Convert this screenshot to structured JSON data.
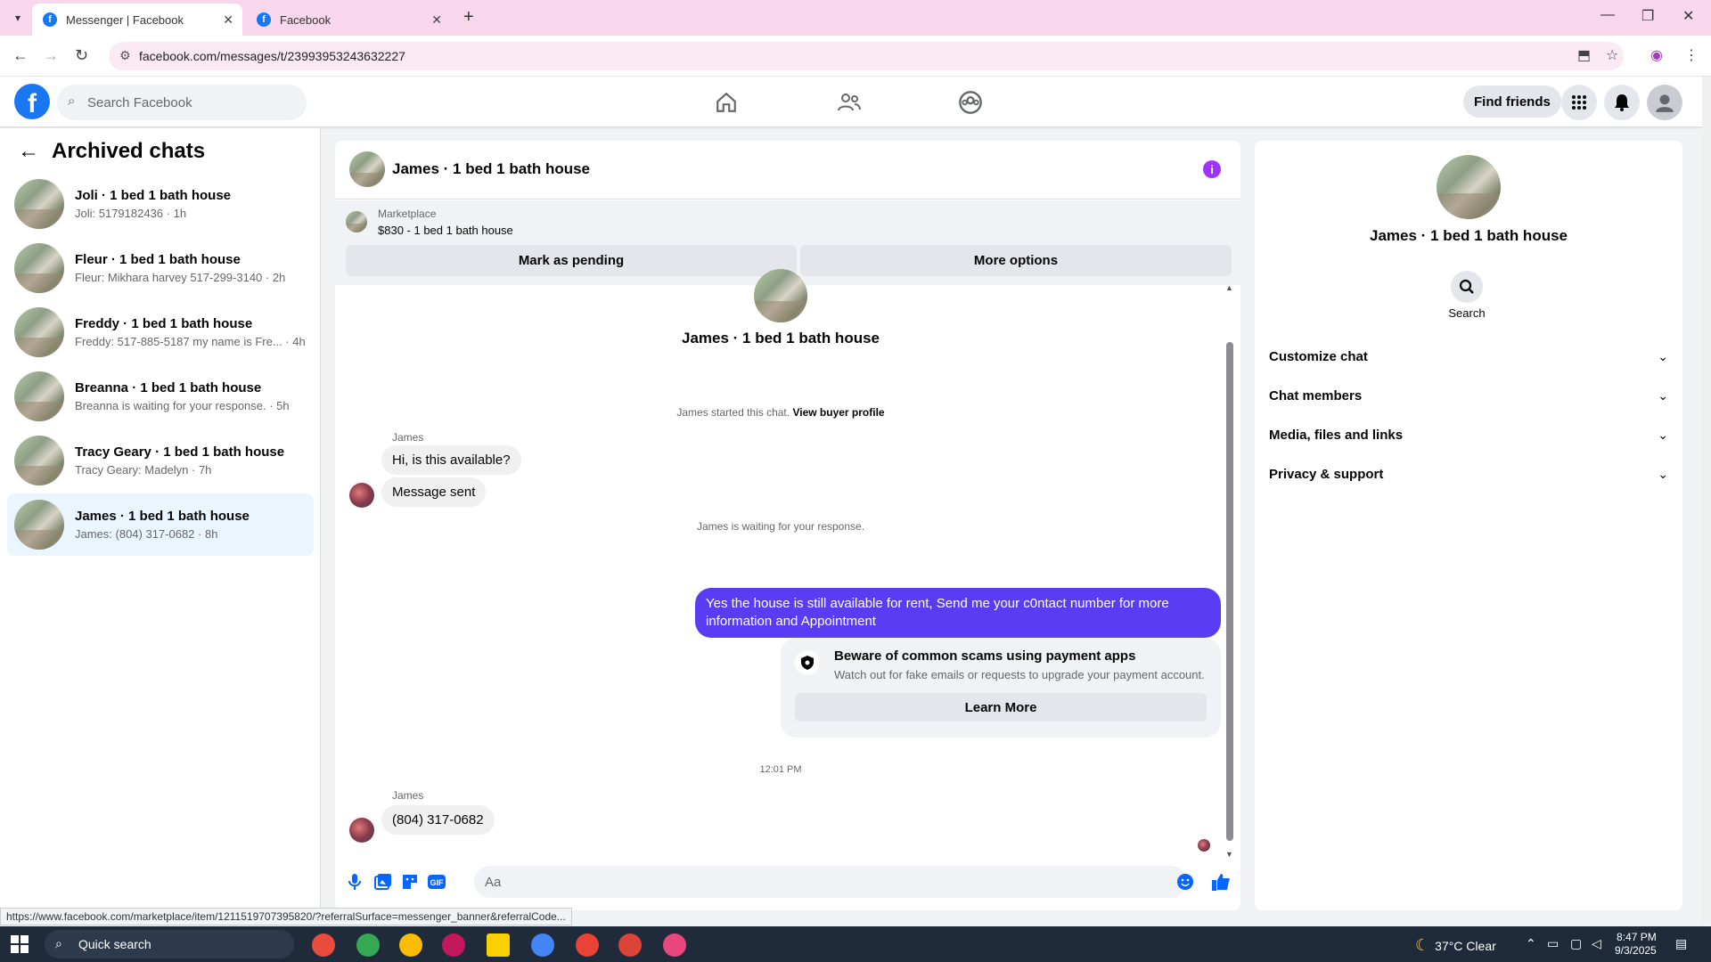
{
  "browser": {
    "tabs": [
      {
        "label": "Messenger | Facebook",
        "active": true
      },
      {
        "label": "Facebook",
        "active": false
      }
    ],
    "url": "facebook.com/messages/t/23993953243632227",
    "status_url": "https://www.facebook.com/marketplace/item/1211519707395820/?referralSurface=messenger_banner&referralCode..."
  },
  "fb_header": {
    "search_placeholder": "Search Facebook",
    "find_friends": "Find friends"
  },
  "sidebar": {
    "title": "Archived chats",
    "chats": [
      {
        "title": "Joli · 1 bed 1 bath house",
        "preview": "Joli: 5179182436 · 1h"
      },
      {
        "title": "Fleur · 1 bed 1 bath house",
        "preview": "Fleur: Mikhara harvey 517-299-3140 · 2h"
      },
      {
        "title": "Freddy · 1 bed 1 bath house",
        "preview": "Freddy: 517-885-5187 my name is Fre... · 4h"
      },
      {
        "title": "Breanna · 1 bed 1 bath house",
        "preview": "Breanna is waiting for your response. · 5h"
      },
      {
        "title": "Tracy Geary · 1 bed 1 bath house",
        "preview": "Tracy Geary: Madelyn · 7h"
      },
      {
        "title": "James · 1 bed 1 bath house",
        "preview": "James: (804) 317-0682 · 8h"
      }
    ]
  },
  "conversation": {
    "header_name": "James · 1 bed 1 bath house",
    "marketplace_label": "Marketplace",
    "listing": "$830 - 1 bed 1 bath house",
    "mark_pending": "Mark as pending",
    "more_options": "More options",
    "center_name": "James · 1 bed 1 bath house",
    "started_text": "James started this chat.",
    "view_buyer_profile": "View buyer profile",
    "sender_name_1": "James",
    "msg_1": "Hi, is this available?",
    "msg_2": "Message sent",
    "waiting_text": "James is waiting for your response.",
    "outgoing_msg": "Yes the house is still available for rent, Send me your c0ntact number for more information and Appointment",
    "scam_title": "Beware of common scams using payment apps",
    "scam_desc": "Watch out for fake emails or requests to upgrade your payment account.",
    "learn_more": "Learn More",
    "timestamp": "12:01 PM",
    "sender_name_2": "James",
    "msg_3": "(804) 317-0682",
    "input_placeholder": "Aa"
  },
  "details_panel": {
    "name": "James · 1 bed 1 bath house",
    "search_label": "Search",
    "sections": [
      "Customize chat",
      "Chat members",
      "Media, files and links",
      "Privacy & support"
    ]
  },
  "taskbar": {
    "search": "Quick search",
    "weather": "37°C  Clear",
    "time": "8:47 PM",
    "date": "9/3/2025"
  },
  "colors": {
    "brand": "#1877f2",
    "outgoing_bubble": "#5b3cf5",
    "info_icon": "#a033ff"
  }
}
